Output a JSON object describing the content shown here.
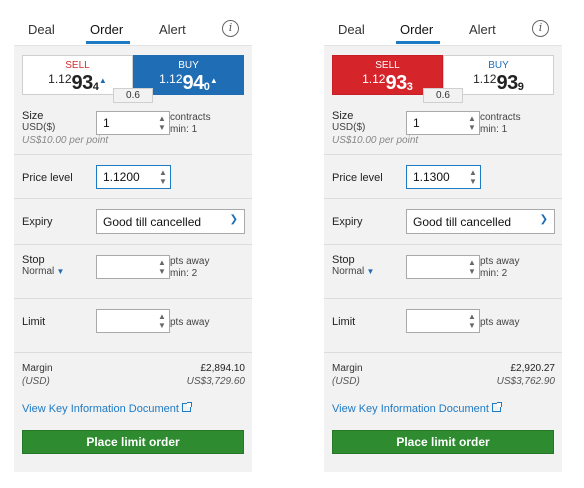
{
  "panels": [
    {
      "tabs": {
        "deal": "Deal",
        "order": "Order",
        "alert": "Alert"
      },
      "info_icon": "info-icon",
      "sell": {
        "label": "SELL",
        "pre": "1.12",
        "big": "93",
        "sub": "4",
        "tri": "▲"
      },
      "buy": {
        "label": "BUY",
        "pre": "1.12",
        "big": "94",
        "sub": "0",
        "tri": "▲"
      },
      "spread": "0.6",
      "size": {
        "label": "Size",
        "currency": "USD($)",
        "value": "1",
        "unit": "contracts",
        "min": "min: 1",
        "per_point": "US$10.00 per point"
      },
      "price_level": {
        "label": "Price level",
        "value": "1.1200"
      },
      "expiry": {
        "label": "Expiry",
        "value": "Good till cancelled"
      },
      "stop": {
        "label": "Stop",
        "type": "Normal",
        "value": "",
        "unit": "pts away",
        "min": "min: 2"
      },
      "limit": {
        "label": "Limit",
        "value": "",
        "unit": "pts away"
      },
      "margin": {
        "label": "Margin",
        "currency": "(USD)",
        "value_gbp": "£2,894.10",
        "value_usd": "US$3,729.60"
      },
      "kid_link": "View Key Information Document",
      "place_button": "Place limit order"
    },
    {
      "tabs": {
        "deal": "Deal",
        "order": "Order",
        "alert": "Alert"
      },
      "info_icon": "info-icon",
      "sell": {
        "label": "SELL",
        "pre": "1.12",
        "big": "93",
        "sub": "3",
        "tri": ""
      },
      "buy": {
        "label": "BUY",
        "pre": "1.12",
        "big": "93",
        "sub": "9",
        "tri": ""
      },
      "spread": "0.6",
      "size": {
        "label": "Size",
        "currency": "USD($)",
        "value": "1",
        "unit": "contracts",
        "min": "min: 1",
        "per_point": "US$10.00 per point"
      },
      "price_level": {
        "label": "Price level",
        "value": "1.1300"
      },
      "expiry": {
        "label": "Expiry",
        "value": "Good till cancelled"
      },
      "stop": {
        "label": "Stop",
        "type": "Normal",
        "value": "",
        "unit": "pts away",
        "min": "min: 2"
      },
      "limit": {
        "label": "Limit",
        "value": "",
        "unit": "pts away"
      },
      "margin": {
        "label": "Margin",
        "currency": "(USD)",
        "value_gbp": "£2,920.27",
        "value_usd": "US$3,762.90"
      },
      "kid_link": "View Key Information Document",
      "place_button": "Place limit order"
    }
  ],
  "colors": {
    "accent": "#1f7ac4",
    "buy_blue": "#1f6db4",
    "sell_red": "#d6242b",
    "button_green": "#2e8b2f"
  }
}
